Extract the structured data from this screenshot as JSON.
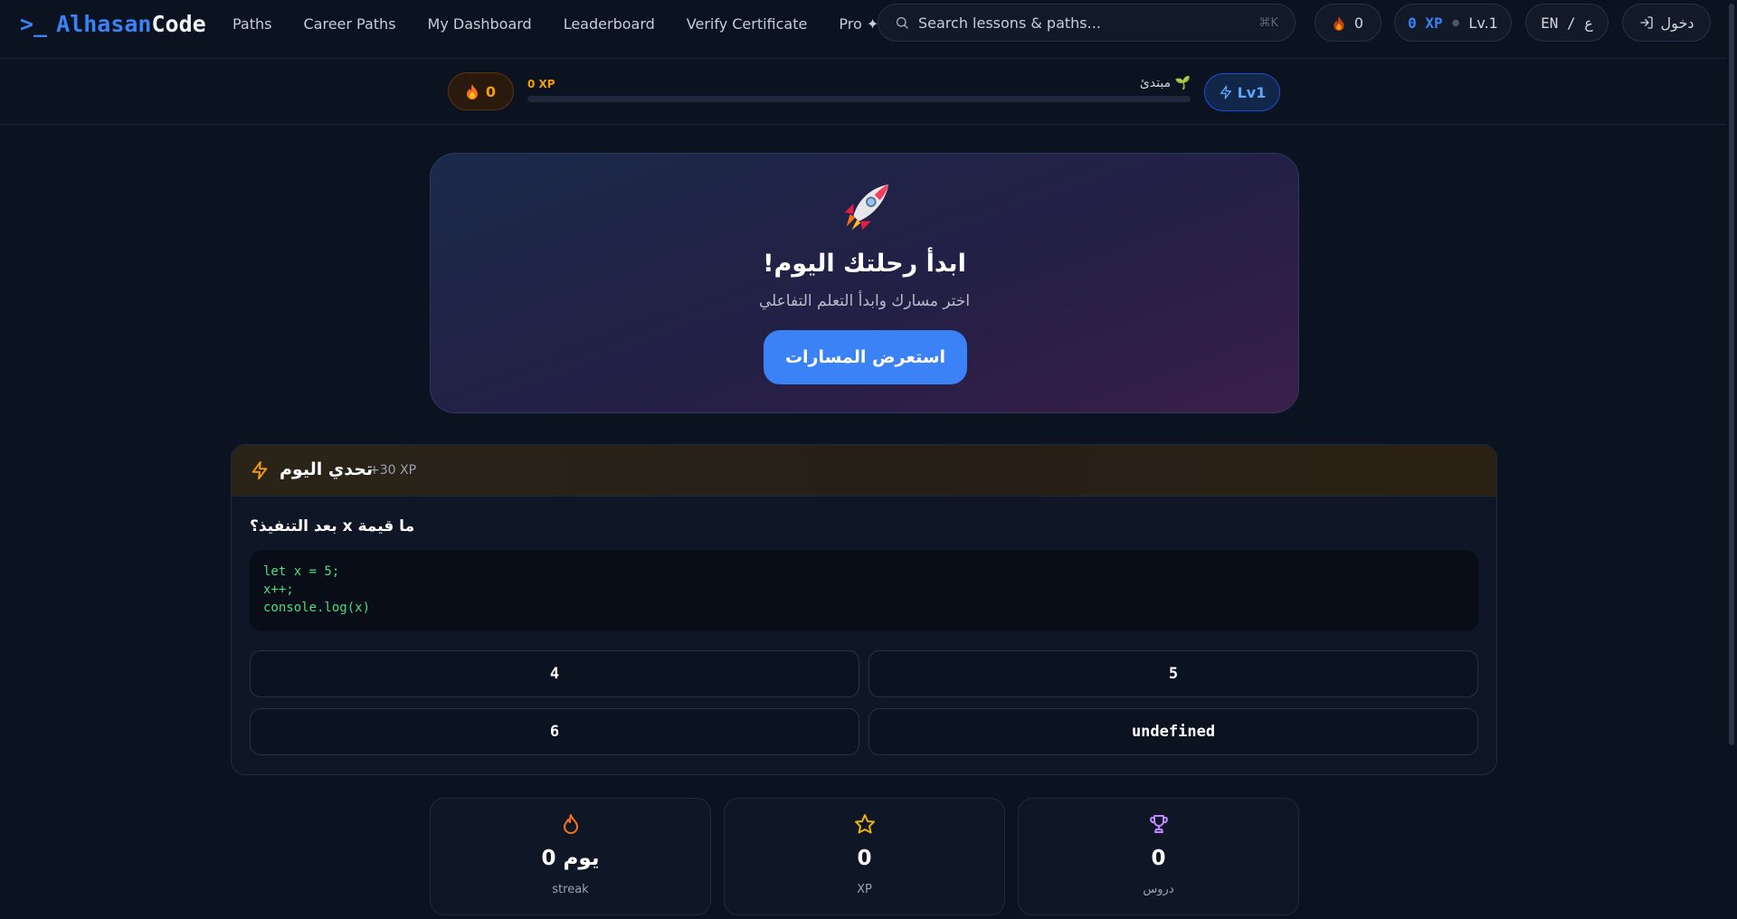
{
  "brand": {
    "prompt": ">_",
    "name_part1": "Alhasan",
    "name_part2": "Code"
  },
  "nav": {
    "links": [
      "Paths",
      "Career Paths",
      "My Dashboard",
      "Leaderboard",
      "Verify Certificate",
      "Pro ✦"
    ]
  },
  "search": {
    "placeholder": "Search lessons & paths...",
    "shortcut": "⌘K"
  },
  "header_stats": {
    "streak": "0",
    "xp": "0 XP",
    "level": "Lv.1",
    "language": "EN / ع",
    "login": "دخول"
  },
  "progress": {
    "streak": "0",
    "rank": "مبتدئ 🌱",
    "xp": "0 XP",
    "fill_percent": 0,
    "level_badge": "Lv1"
  },
  "hero": {
    "title": "!ابدأ رحلتك اليوم",
    "subtitle": "اختر مسارك وابدأ التعلم التفاعلي",
    "cta": "استعرض المسارات"
  },
  "challenge": {
    "title": "تحدي اليوم",
    "reward": "+30 XP",
    "question": "بعد التنفيذ؟ x ما قيمة",
    "code_lines": [
      "let x = 5;",
      "x++;",
      "console.log(x)"
    ],
    "options": [
      "4",
      "5",
      "6",
      "undefined"
    ]
  },
  "stats": [
    {
      "value": "يوم 0",
      "label": "streak",
      "icon": "flame-icon",
      "color": "#f97316"
    },
    {
      "value": "0",
      "label": "XP",
      "icon": "star-icon",
      "color": "#eab308"
    },
    {
      "value": "0",
      "label": "دروس",
      "icon": "trophy-icon",
      "color": "#c084fc"
    }
  ],
  "colors": {
    "accent": "#3b82f6",
    "background": "#0b1220",
    "xp_gold": "#f59e0b"
  }
}
